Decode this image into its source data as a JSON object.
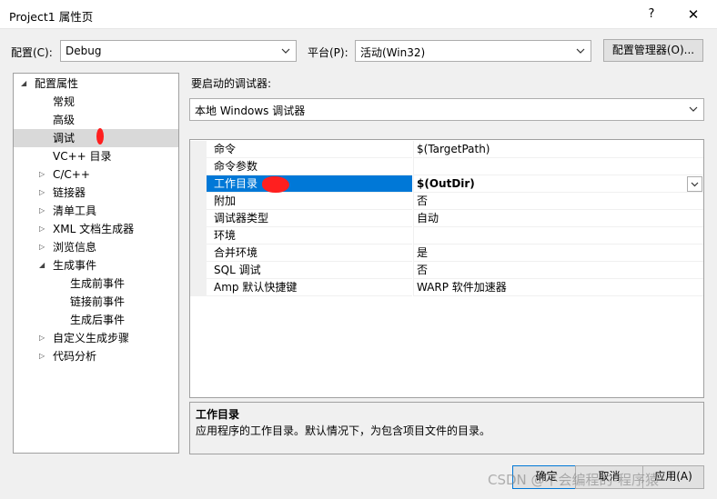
{
  "window": {
    "title": "Project1 属性页",
    "help": "?",
    "close": "✕"
  },
  "toolbar": {
    "config_label": "配置(C):",
    "config_value": "Debug",
    "platform_label": "平台(P):",
    "platform_value": "活动(Win32)",
    "config_manager": "配置管理器(O)..."
  },
  "tree": {
    "root": "配置属性",
    "items": [
      "常规",
      "高级",
      "调试",
      "VC++ 目录",
      "C/C++",
      "链接器",
      "清单工具",
      "XML 文档生成器",
      "浏览信息",
      "生成事件",
      "生成前事件",
      "链接前事件",
      "生成后事件",
      "自定义生成步骤",
      "代码分析"
    ],
    "selected": "调试"
  },
  "debugger": {
    "label": "要启动的调试器:",
    "value": "本地 Windows 调试器"
  },
  "properties": [
    {
      "name": "命令",
      "value": "$(TargetPath)"
    },
    {
      "name": "命令参数",
      "value": ""
    },
    {
      "name": "工作目录",
      "value": "$(OutDir)"
    },
    {
      "name": "附加",
      "value": "否"
    },
    {
      "name": "调试器类型",
      "value": "自动"
    },
    {
      "name": "环境",
      "value": ""
    },
    {
      "name": "合并环境",
      "value": "是"
    },
    {
      "name": "SQL 调试",
      "value": "否"
    },
    {
      "name": "Amp 默认快捷键",
      "value": "WARP 软件加速器"
    }
  ],
  "description": {
    "title": "工作目录",
    "text": "应用程序的工作目录。默认情况下，为包含项目文件的目录。"
  },
  "buttons": {
    "ok": "确定",
    "cancel": "取消",
    "apply": "应用(A)"
  },
  "watermark": "CSDN @不会编程的-程序猿",
  "colors": {
    "selection": "#0078d7",
    "annotation": "#ff1f1f"
  }
}
